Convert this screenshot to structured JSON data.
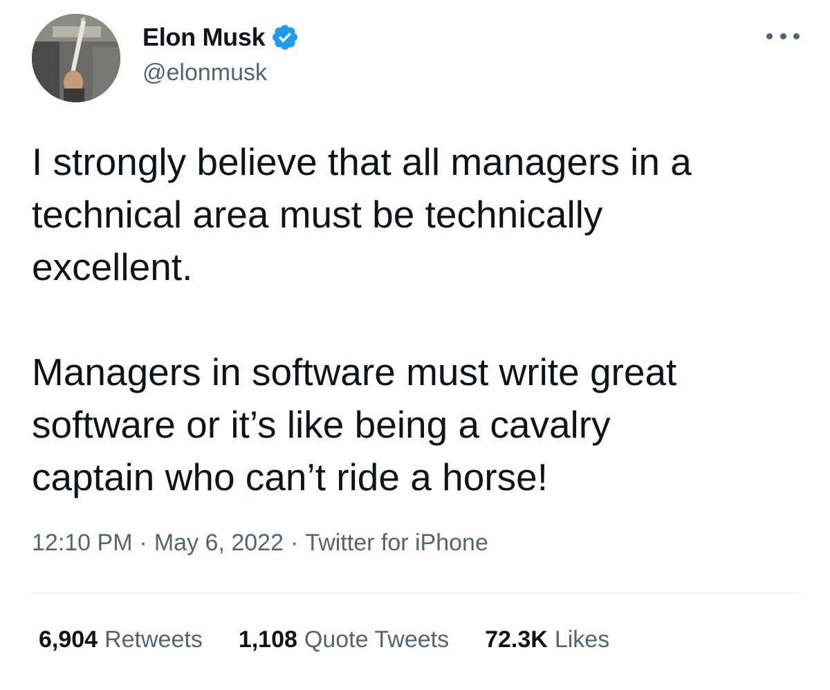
{
  "author": {
    "display_name": "Elon Musk",
    "handle": "@elonmusk",
    "verified_icon": "verified-badge-icon",
    "avatar_icon": "profile-avatar"
  },
  "menu": {
    "icon": "more-options-icon"
  },
  "tweet": {
    "paragraphs": [
      "I strongly believe that all managers in a\ntechnical area must be technically\nexcellent.",
      "Managers in software must write great\nsoftware or it’s like being a cavalry\ncaptain who can’t ride a horse!"
    ]
  },
  "meta": {
    "time": "12:10 PM",
    "date": "May 6, 2022",
    "separator": "·",
    "source": "Twitter for iPhone"
  },
  "stats": {
    "retweets": {
      "count": "6,904",
      "label": "Retweets"
    },
    "quotes": {
      "count": "1,108",
      "label": "Quote Tweets"
    },
    "likes": {
      "count": "72.3K",
      "label": "Likes"
    }
  },
  "colors": {
    "text": "#0f1419",
    "secondary": "#536471",
    "verified": "#1d9bf0",
    "divider": "#eff3f4"
  }
}
